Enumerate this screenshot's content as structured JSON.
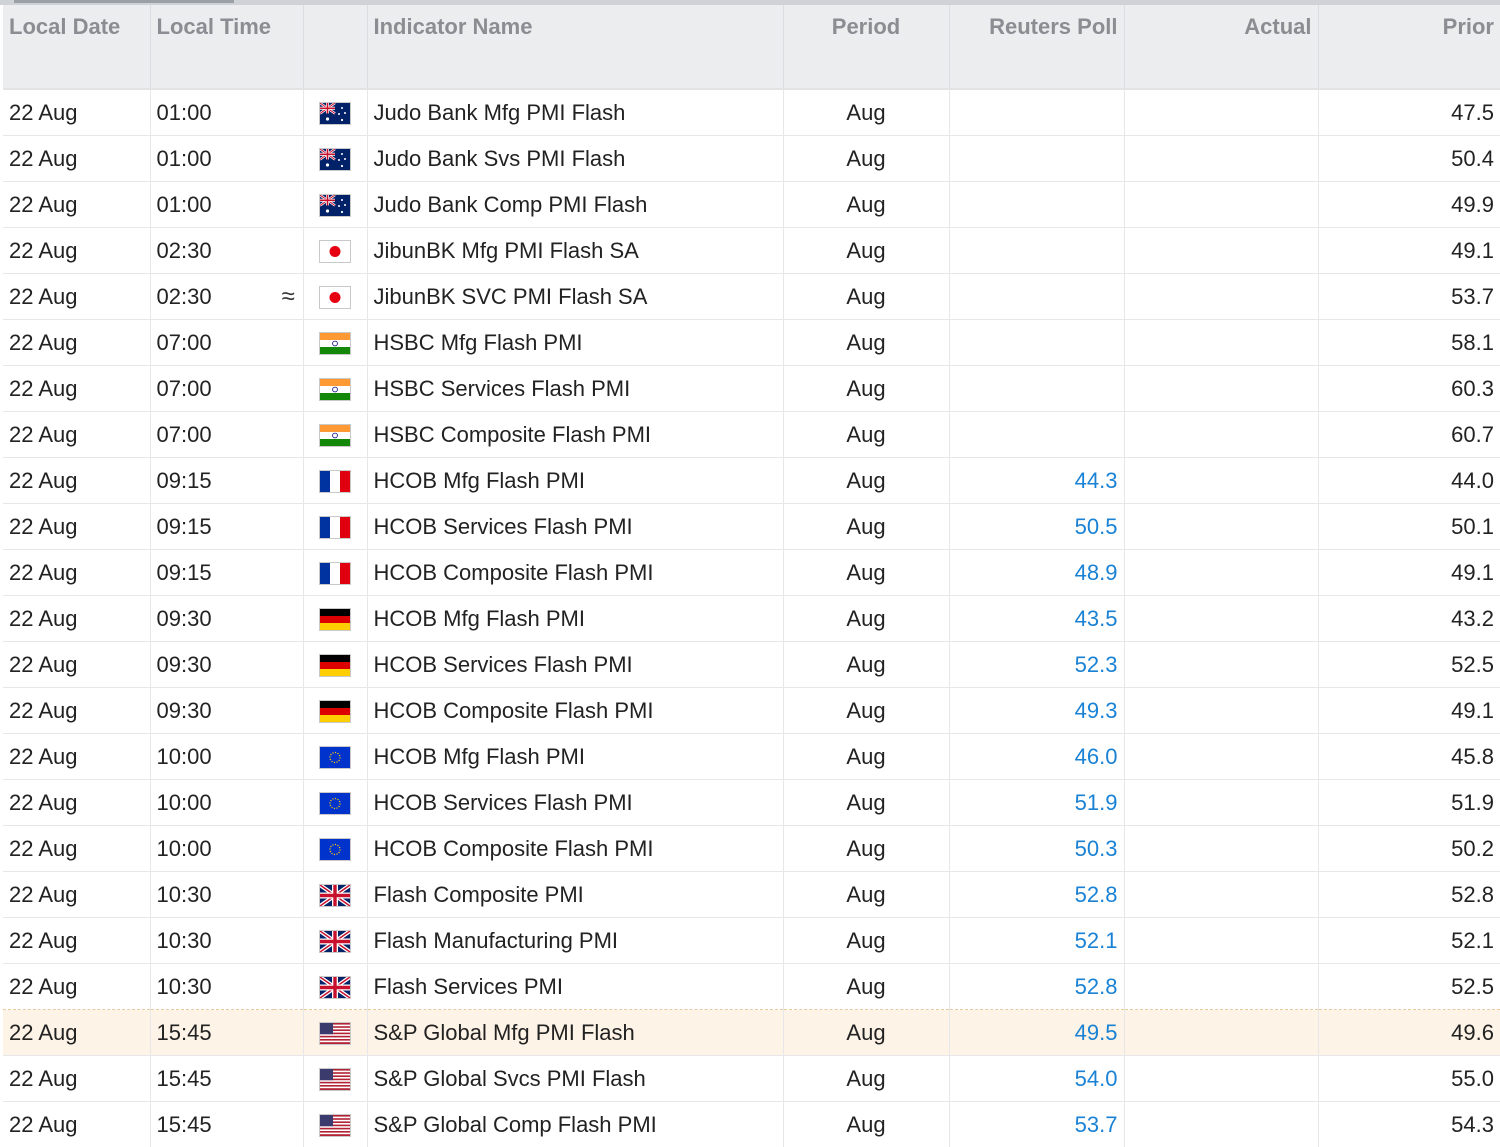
{
  "columns": {
    "date": "Local Date",
    "time": "Local Time",
    "indicator": "Indicator Name",
    "period": "Period",
    "poll": "Reuters Poll",
    "actual": "Actual",
    "prior": "Prior"
  },
  "highlight_color": "#fdf3e6",
  "poll_color": "#1a82d4",
  "rows": [
    {
      "date": "22 Aug",
      "time": "01:00",
      "alert": "",
      "flag": "australia-flag-icon",
      "indicator": "Judo Bank Mfg PMI Flash",
      "period": "Aug",
      "poll": "",
      "actual": "",
      "prior": "47.5"
    },
    {
      "date": "22 Aug",
      "time": "01:00",
      "alert": "",
      "flag": "australia-flag-icon",
      "indicator": "Judo Bank Svs PMI Flash",
      "period": "Aug",
      "poll": "",
      "actual": "",
      "prior": "50.4"
    },
    {
      "date": "22 Aug",
      "time": "01:00",
      "alert": "",
      "flag": "australia-flag-icon",
      "indicator": "Judo Bank Comp PMI Flash",
      "period": "Aug",
      "poll": "",
      "actual": "",
      "prior": "49.9"
    },
    {
      "date": "22 Aug",
      "time": "02:30",
      "alert": "",
      "flag": "japan-flag-icon",
      "indicator": "JibunBK Mfg PMI Flash SA",
      "period": "Aug",
      "poll": "",
      "actual": "",
      "prior": "49.1"
    },
    {
      "date": "22 Aug",
      "time": "02:30",
      "alert": "≈",
      "flag": "japan-flag-icon",
      "indicator": "JibunBK SVC PMI Flash SA",
      "period": "Aug",
      "poll": "",
      "actual": "",
      "prior": "53.7"
    },
    {
      "date": "22 Aug",
      "time": "07:00",
      "alert": "",
      "flag": "india-flag-icon",
      "indicator": "HSBC Mfg Flash PMI",
      "period": "Aug",
      "poll": "",
      "actual": "",
      "prior": "58.1"
    },
    {
      "date": "22 Aug",
      "time": "07:00",
      "alert": "",
      "flag": "india-flag-icon",
      "indicator": "HSBC Services Flash PMI",
      "period": "Aug",
      "poll": "",
      "actual": "",
      "prior": "60.3"
    },
    {
      "date": "22 Aug",
      "time": "07:00",
      "alert": "",
      "flag": "india-flag-icon",
      "indicator": "HSBC Composite Flash PMI",
      "period": "Aug",
      "poll": "",
      "actual": "",
      "prior": "60.7"
    },
    {
      "date": "22 Aug",
      "time": "09:15",
      "alert": "",
      "flag": "france-flag-icon",
      "indicator": "HCOB Mfg Flash PMI",
      "period": "Aug",
      "poll": "44.3",
      "actual": "",
      "prior": "44.0"
    },
    {
      "date": "22 Aug",
      "time": "09:15",
      "alert": "",
      "flag": "france-flag-icon",
      "indicator": "HCOB Services Flash PMI",
      "period": "Aug",
      "poll": "50.5",
      "actual": "",
      "prior": "50.1"
    },
    {
      "date": "22 Aug",
      "time": "09:15",
      "alert": "",
      "flag": "france-flag-icon",
      "indicator": "HCOB Composite Flash PMI",
      "period": "Aug",
      "poll": "48.9",
      "actual": "",
      "prior": "49.1"
    },
    {
      "date": "22 Aug",
      "time": "09:30",
      "alert": "",
      "flag": "germany-flag-icon",
      "indicator": "HCOB Mfg Flash PMI",
      "period": "Aug",
      "poll": "43.5",
      "actual": "",
      "prior": "43.2"
    },
    {
      "date": "22 Aug",
      "time": "09:30",
      "alert": "",
      "flag": "germany-flag-icon",
      "indicator": "HCOB Services Flash PMI",
      "period": "Aug",
      "poll": "52.3",
      "actual": "",
      "prior": "52.5"
    },
    {
      "date": "22 Aug",
      "time": "09:30",
      "alert": "",
      "flag": "germany-flag-icon",
      "indicator": "HCOB Composite Flash PMI",
      "period": "Aug",
      "poll": "49.3",
      "actual": "",
      "prior": "49.1"
    },
    {
      "date": "22 Aug",
      "time": "10:00",
      "alert": "",
      "flag": "eu-flag-icon",
      "indicator": "HCOB Mfg Flash PMI",
      "period": "Aug",
      "poll": "46.0",
      "actual": "",
      "prior": "45.8"
    },
    {
      "date": "22 Aug",
      "time": "10:00",
      "alert": "",
      "flag": "eu-flag-icon",
      "indicator": "HCOB Services Flash PMI",
      "period": "Aug",
      "poll": "51.9",
      "actual": "",
      "prior": "51.9"
    },
    {
      "date": "22 Aug",
      "time": "10:00",
      "alert": "",
      "flag": "eu-flag-icon",
      "indicator": "HCOB Composite Flash PMI",
      "period": "Aug",
      "poll": "50.3",
      "actual": "",
      "prior": "50.2"
    },
    {
      "date": "22 Aug",
      "time": "10:30",
      "alert": "",
      "flag": "uk-flag-icon",
      "indicator": "Flash Composite PMI",
      "period": "Aug",
      "poll": "52.8",
      "actual": "",
      "prior": "52.8"
    },
    {
      "date": "22 Aug",
      "time": "10:30",
      "alert": "",
      "flag": "uk-flag-icon",
      "indicator": "Flash Manufacturing PMI",
      "period": "Aug",
      "poll": "52.1",
      "actual": "",
      "prior": "52.1"
    },
    {
      "date": "22 Aug",
      "time": "10:30",
      "alert": "",
      "flag": "uk-flag-icon",
      "indicator": "Flash Services PMI",
      "period": "Aug",
      "poll": "52.8",
      "actual": "",
      "prior": "52.5"
    },
    {
      "date": "22 Aug",
      "time": "15:45",
      "alert": "",
      "flag": "usa-flag-icon",
      "indicator": "S&P Global Mfg PMI Flash",
      "period": "Aug",
      "poll": "49.5",
      "actual": "",
      "prior": "49.6",
      "highlighted": true
    },
    {
      "date": "22 Aug",
      "time": "15:45",
      "alert": "",
      "flag": "usa-flag-icon",
      "indicator": "S&P Global Svcs PMI Flash",
      "period": "Aug",
      "poll": "54.0",
      "actual": "",
      "prior": "55.0"
    },
    {
      "date": "22 Aug",
      "time": "15:45",
      "alert": "",
      "flag": "usa-flag-icon",
      "indicator": "S&P Global Comp Flash PMI",
      "period": "Aug",
      "poll": "53.7",
      "actual": "",
      "prior": "54.3"
    }
  ]
}
